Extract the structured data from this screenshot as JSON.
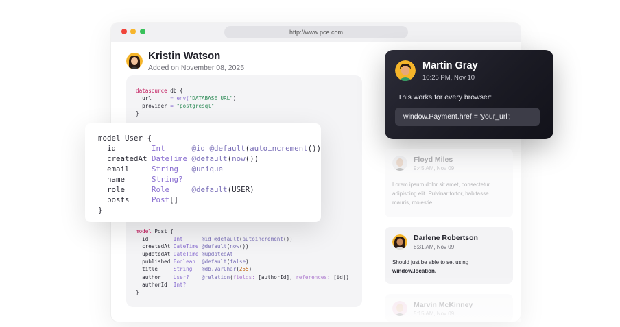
{
  "browser": {
    "url": "http://www.pce.com"
  },
  "post": {
    "author": "Kristin Watson",
    "date": "Added on November 08, 2025"
  },
  "code": {
    "datasource": [
      [
        {
          "c": "k",
          "t": "datasource"
        },
        {
          "t": " db {"
        }
      ],
      [
        {
          "t": "  url      "
        },
        {
          "c": "t",
          "t": "= env("
        },
        {
          "c": "s",
          "t": "\"DATABASE_URL\""
        },
        {
          "t": ")"
        }
      ],
      [
        {
          "t": "  provider "
        },
        {
          "c": "t",
          "t": "= "
        },
        {
          "c": "s",
          "t": "\"postgresql\""
        }
      ],
      [
        {
          "t": "}"
        }
      ]
    ],
    "user_model": [
      [
        {
          "t": "model User {"
        }
      ],
      [
        {
          "t": "  id        "
        },
        {
          "c": "t",
          "t": "Int"
        },
        {
          "t": "      "
        },
        {
          "c": "a",
          "t": "@id @default"
        },
        {
          "t": "("
        },
        {
          "c": "a",
          "t": "autoincrement"
        },
        {
          "t": "())"
        }
      ],
      [
        {
          "t": "  createdAt "
        },
        {
          "c": "t",
          "t": "DateTime"
        },
        {
          "t": " "
        },
        {
          "c": "a",
          "t": "@default"
        },
        {
          "t": "("
        },
        {
          "c": "a",
          "t": "now"
        },
        {
          "t": "())"
        }
      ],
      [
        {
          "t": "  email     "
        },
        {
          "c": "t",
          "t": "String"
        },
        {
          "t": "   "
        },
        {
          "c": "a",
          "t": "@unique"
        }
      ],
      [
        {
          "t": "  name      "
        },
        {
          "c": "t",
          "t": "String?"
        }
      ],
      [
        {
          "t": "  role      "
        },
        {
          "c": "t",
          "t": "Role"
        },
        {
          "t": "     "
        },
        {
          "c": "a",
          "t": "@default"
        },
        {
          "t": "(USER)"
        }
      ],
      [
        {
          "t": "  posts     "
        },
        {
          "c": "t",
          "t": "Post"
        },
        {
          "t": "[]"
        }
      ],
      [
        {
          "t": "}"
        }
      ]
    ],
    "post_model": [
      [
        {
          "c": "k",
          "t": "model"
        },
        {
          "t": " Post {"
        }
      ],
      [
        {
          "t": "  id        "
        },
        {
          "c": "t",
          "t": "Int"
        },
        {
          "t": "      "
        },
        {
          "c": "a",
          "t": "@id @default"
        },
        {
          "t": "("
        },
        {
          "c": "a",
          "t": "autoincrement"
        },
        {
          "t": "())"
        }
      ],
      [
        {
          "t": "  createdAt "
        },
        {
          "c": "t",
          "t": "DateTime"
        },
        {
          "t": " "
        },
        {
          "c": "a",
          "t": "@default"
        },
        {
          "t": "("
        },
        {
          "c": "a",
          "t": "now"
        },
        {
          "t": "())"
        }
      ],
      [
        {
          "t": "  updatedAt "
        },
        {
          "c": "t",
          "t": "DateTime"
        },
        {
          "t": " "
        },
        {
          "c": "a",
          "t": "@updatedAt"
        }
      ],
      [
        {
          "t": "  published "
        },
        {
          "c": "t",
          "t": "Boolean"
        },
        {
          "t": "  "
        },
        {
          "c": "a",
          "t": "@default"
        },
        {
          "t": "("
        },
        {
          "c": "a",
          "t": "false"
        },
        {
          "t": ")"
        }
      ],
      [
        {
          "t": "  title     "
        },
        {
          "c": "t",
          "t": "String"
        },
        {
          "t": "   "
        },
        {
          "c": "a",
          "t": "@db.VarChar"
        },
        {
          "t": "("
        },
        {
          "c": "f",
          "t": "255"
        },
        {
          "t": ")"
        }
      ],
      [
        {
          "t": "  author    "
        },
        {
          "c": "t",
          "t": "User?"
        },
        {
          "t": "    "
        },
        {
          "c": "a",
          "t": "@relation"
        },
        {
          "t": "("
        },
        {
          "c": "q",
          "t": "fields:"
        },
        {
          "t": " [authorId], "
        },
        {
          "c": "q",
          "t": "references:"
        },
        {
          "t": " [id])"
        }
      ],
      [
        {
          "t": "  authorId  "
        },
        {
          "c": "t",
          "t": "Int?"
        }
      ],
      [
        {
          "t": "}"
        }
      ]
    ]
  },
  "comments": {
    "martin": {
      "name": "Martin Gray",
      "time": "10:25 PM, Nov 10",
      "message": "This works for every browser:",
      "code": "window.Payment.href = 'your_url';"
    },
    "floyd": {
      "name": "Floyd Miles",
      "time": "9:45 AM, Nov 09",
      "message": "Lorem ipsum dolor sit amet, consectetur adipiscing elit. Pulvinar tortor, habitasse mauris, molestie."
    },
    "darlene": {
      "name": "Darlene Robertson",
      "time": "8:31 AM, Nov 09",
      "message": "Should just be able to set using",
      "code": "window.location."
    },
    "marvin": {
      "name": "Marvin McKinney",
      "time": "5:15 AM, Nov 09"
    }
  },
  "colors": {
    "keyword": "#c2185b",
    "type": "#8a6fd1",
    "attribute": "#7a6fb8",
    "string": "#2e8b57",
    "number": "#c46b1f",
    "dark_card": "#1a1a23"
  }
}
